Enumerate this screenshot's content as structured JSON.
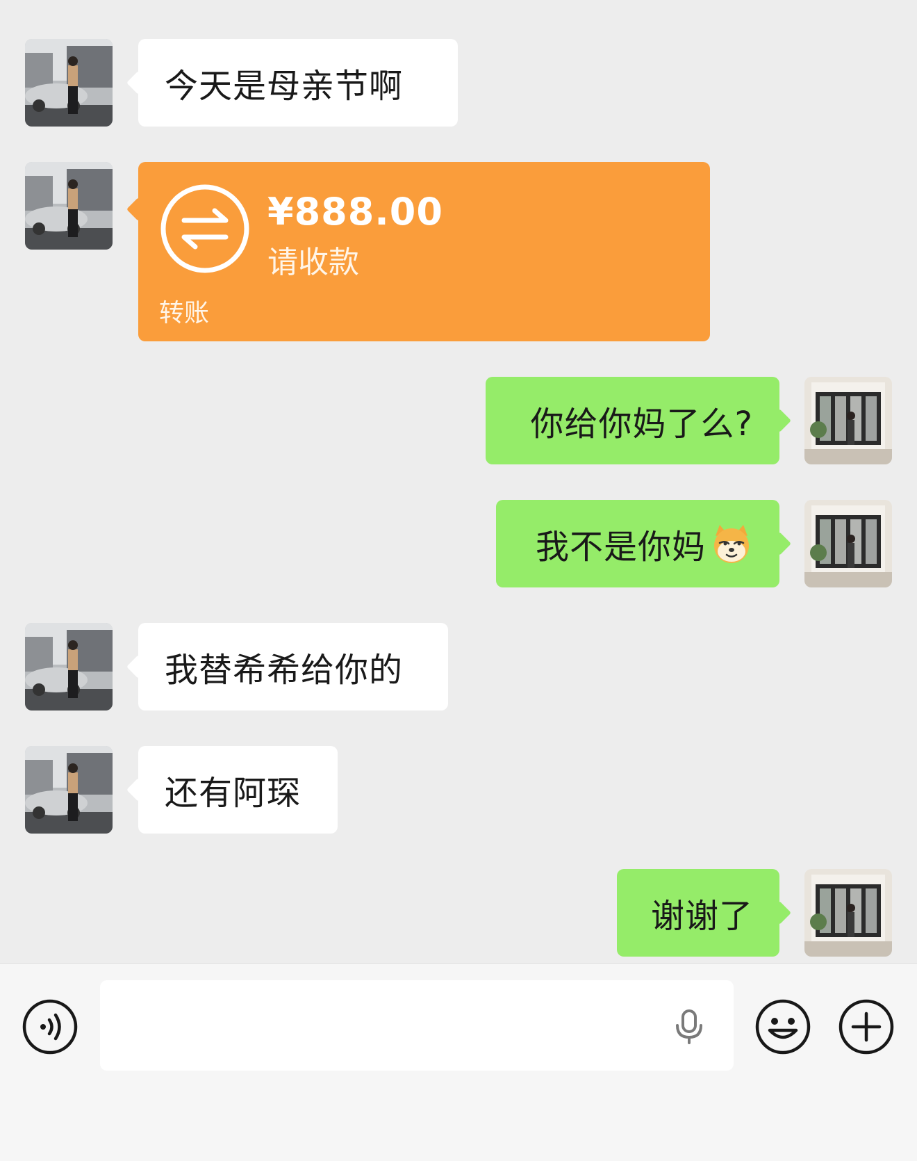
{
  "messages": [
    {
      "side": "left",
      "type": "text",
      "text": "今天是母亲节啊"
    },
    {
      "side": "left",
      "type": "transfer",
      "amount": "¥888.00",
      "note": "请收款",
      "label": "转账"
    },
    {
      "side": "right",
      "type": "text",
      "text": "你给你妈了么?"
    },
    {
      "side": "right",
      "type": "text",
      "text": "我不是你妈",
      "emoji": "doge-emoji"
    },
    {
      "side": "left",
      "type": "text",
      "text": "我替希希给你的"
    },
    {
      "side": "left",
      "type": "text",
      "text": "还有阿琛"
    },
    {
      "side": "right",
      "type": "text",
      "text": "谢谢了"
    }
  ],
  "input": {
    "placeholder": "",
    "value": ""
  },
  "icons": {
    "voice": "voice-mode-icon",
    "mic": "microphone-icon",
    "emoji": "emoji-smile-icon",
    "plus": "plus-icon",
    "transfer": "transfer-arrows-icon"
  },
  "colors": {
    "background": "#ededed",
    "sent_bubble": "#95ec69",
    "received_bubble": "#ffffff",
    "transfer_bubble": "#fa9d3b"
  }
}
